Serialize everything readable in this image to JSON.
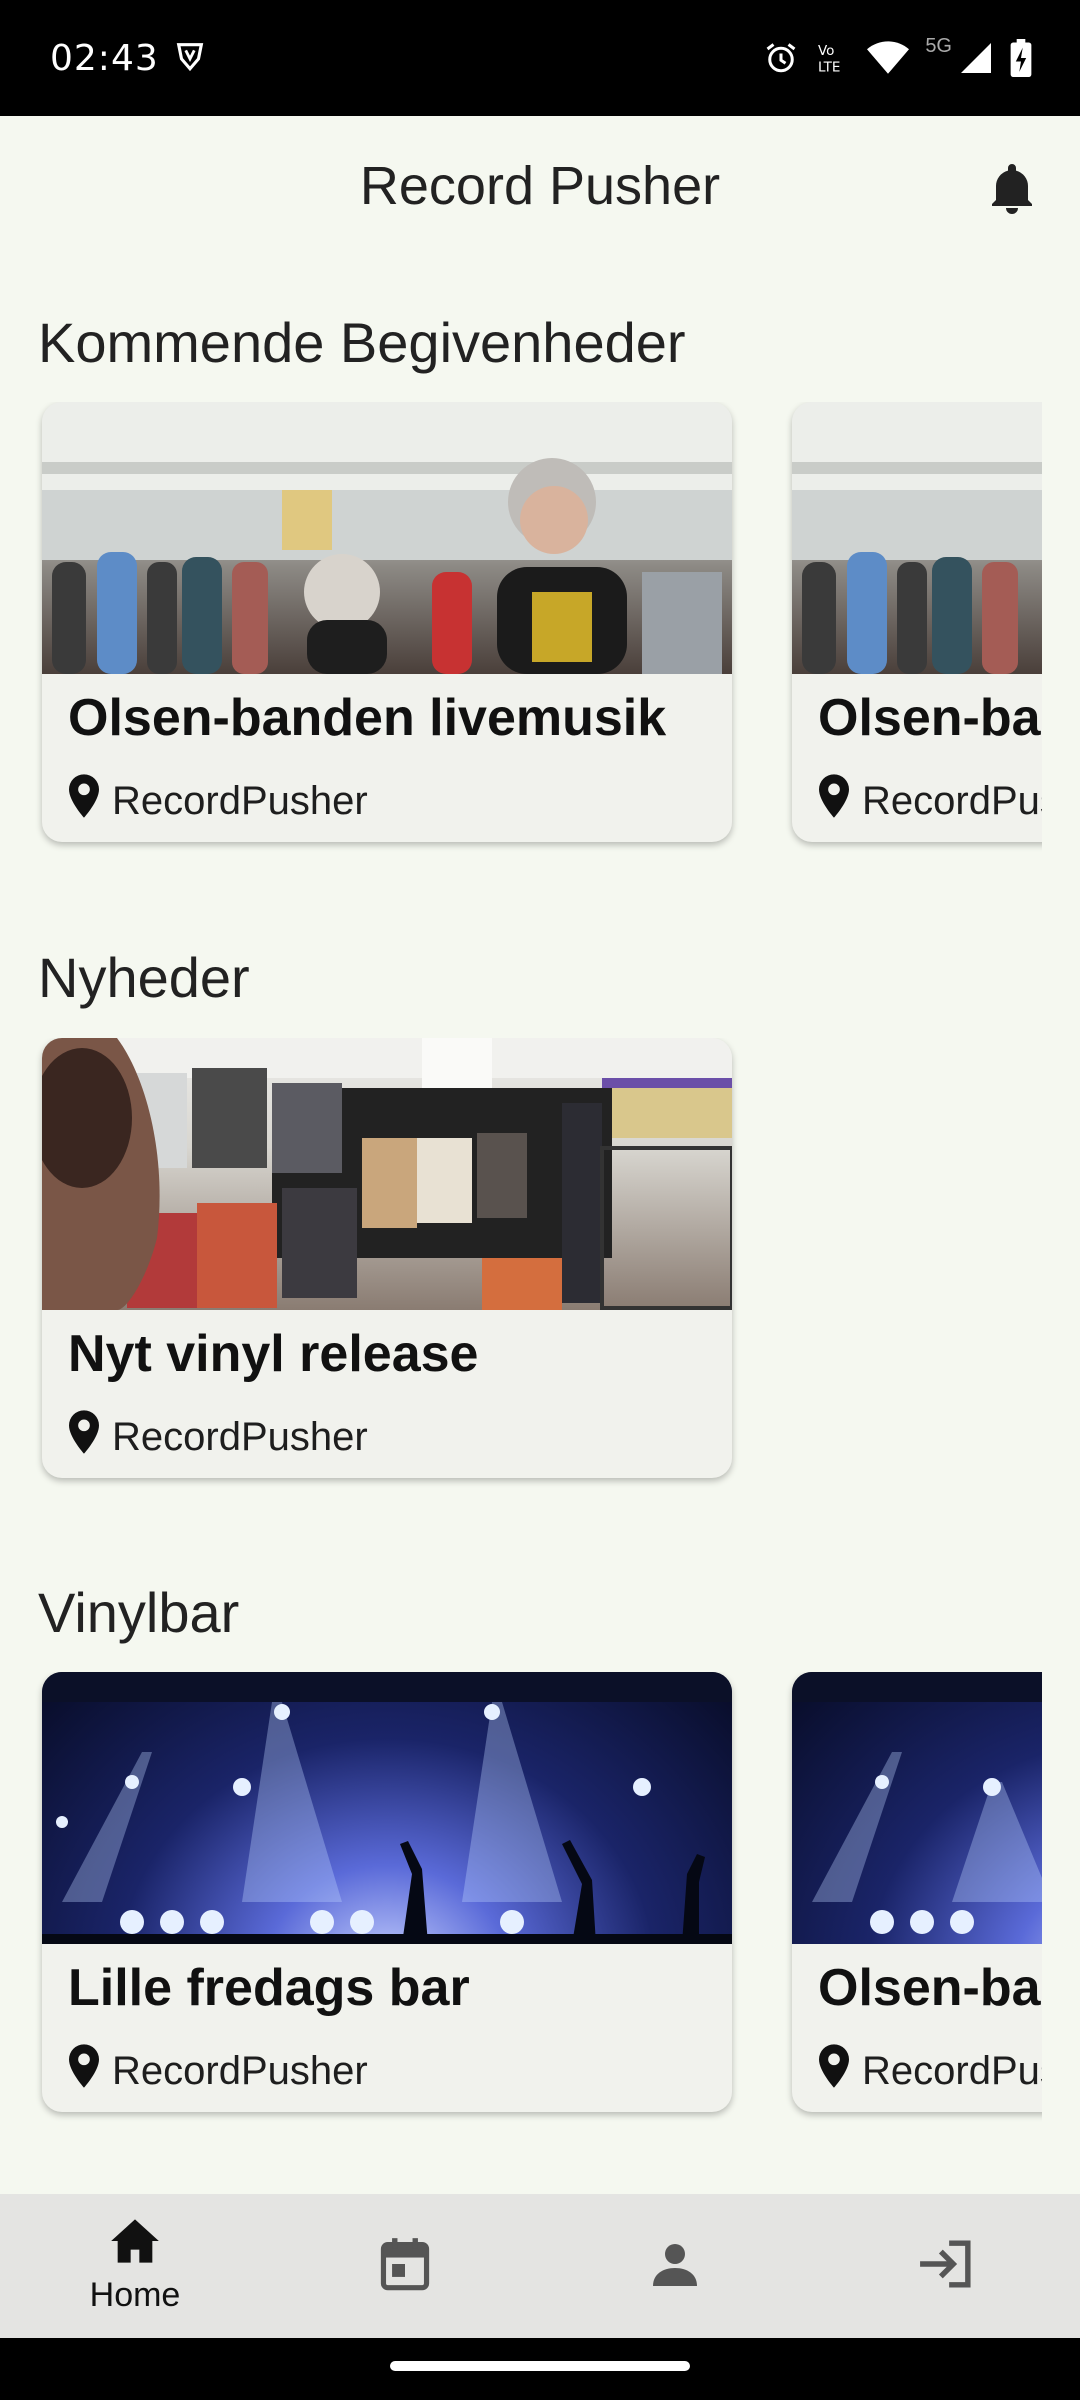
{
  "status_bar": {
    "time": "02:43",
    "network": "5G"
  },
  "app_bar": {
    "title": "Record Pusher"
  },
  "sections": [
    {
      "title": "Kommende Begivenheder",
      "cards": [
        {
          "title": "Olsen-banden livemusik",
          "location": "RecordPusher",
          "image": "record-fair-crowd"
        },
        {
          "title": "Olsen-banden livemusik",
          "location": "RecordPusher",
          "image": "record-fair-crowd"
        }
      ]
    },
    {
      "title": "Nyheder",
      "cards": [
        {
          "title": "Nyt vinyl release",
          "location": "RecordPusher",
          "image": "vinyl-records-display"
        }
      ]
    },
    {
      "title": "Vinylbar",
      "cards": [
        {
          "title": "Lille fredags bar",
          "location": "RecordPusher",
          "image": "concert-lights-crowd"
        },
        {
          "title": "Olsen-banden livemusik",
          "location": "RecordPusher",
          "image": "concert-lights-crowd"
        }
      ]
    }
  ],
  "bottom_nav": {
    "items": [
      {
        "label": "Home",
        "icon": "home-icon",
        "active": true
      },
      {
        "label": "",
        "icon": "calendar-icon",
        "active": false
      },
      {
        "label": "",
        "icon": "person-icon",
        "active": false
      },
      {
        "label": "",
        "icon": "login-icon",
        "active": false
      }
    ]
  },
  "colors": {
    "background": "#f5f8f0",
    "card": "#f1f2ed",
    "nav": "#e4e4e2"
  }
}
